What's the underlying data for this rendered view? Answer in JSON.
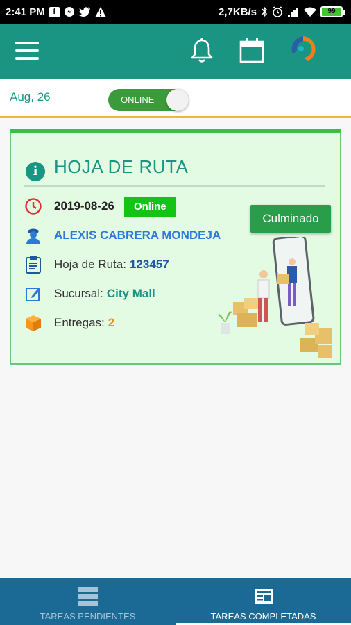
{
  "status_bar": {
    "time": "2:41 PM",
    "net_speed": "2,7KB/s",
    "battery": "99"
  },
  "app_bar": {
    "icons": [
      "menu-icon",
      "bell-icon",
      "calendar-icon",
      "brand-logo"
    ]
  },
  "date_row": {
    "date": "Aug, 26",
    "toggle_label": "ONLINE"
  },
  "card": {
    "title": "HOJA DE RUTA",
    "date": "2019-08-26",
    "status_badge": "Online",
    "driver_name": "ALEXIS CABRERA MONDEJA",
    "route_label": "Hoja de Ruta:",
    "route_value": "123457",
    "branch_label": "Sucursal:",
    "branch_value": "City Mall",
    "deliveries_label": "Entregas:",
    "deliveries_value": "2",
    "action_label": "Culminado"
  },
  "bottom_nav": {
    "tabs": [
      {
        "label": "TAREAS PENDIENTES",
        "icon": "list-icon",
        "selected": false
      },
      {
        "label": "TAREAS COMPLETADAS",
        "icon": "completed-icon",
        "selected": true
      }
    ]
  },
  "colors": {
    "primary": "#1a9584",
    "accent_line": "#f5b731",
    "card_bg": "#e3fae3",
    "badge_green": "#14c414",
    "nav_bg": "#1b6a96"
  }
}
